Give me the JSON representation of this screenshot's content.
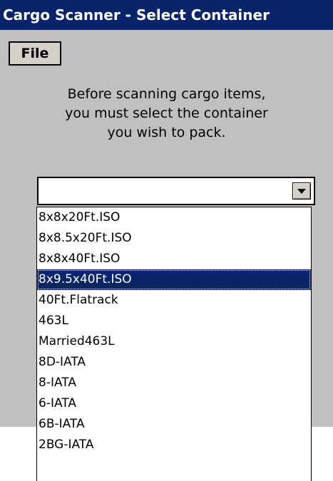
{
  "window": {
    "title": "Cargo Scanner - Select Container"
  },
  "menu": {
    "file_label": "File"
  },
  "instructions": {
    "lines": [
      "Before scanning cargo items,",
      "you must select the container",
      "you wish to pack."
    ]
  },
  "combo": {
    "value": ""
  },
  "dropdown": {
    "items": [
      "8x8x20Ft.ISO",
      "8x8.5x20Ft.ISO",
      "8x8x40Ft.ISO",
      "8x9.5x40Ft.ISO",
      "40Ft.Flatrack",
      "463L",
      "Married463L",
      "8D-IATA",
      "8-IATA",
      "6-IATA",
      "6B-IATA",
      "2BG-IATA"
    ],
    "selected_item": "8x9.5x40Ft.ISO"
  },
  "colors": {
    "title_bg": "#0a246a",
    "client_bg": "#c0c0c0",
    "selection_bg": "#0a246a"
  }
}
